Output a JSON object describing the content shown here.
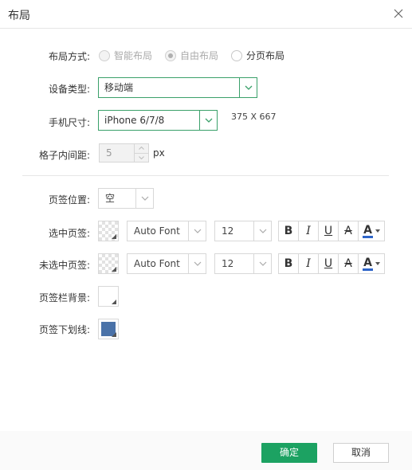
{
  "dialog": {
    "title": "布局",
    "icons": {
      "close": "close-icon",
      "dropdown": "chevron-down-icon"
    }
  },
  "layout_mode": {
    "label": "布局方式:",
    "options": [
      {
        "label": "智能布局",
        "checked": false,
        "disabled": true
      },
      {
        "label": "自由布局",
        "checked": true,
        "disabled": true
      },
      {
        "label": "分页布局",
        "checked": false,
        "disabled": false
      }
    ]
  },
  "device_type": {
    "label": "设备类型:",
    "value": "移动端"
  },
  "phone_size": {
    "label": "手机尺寸:",
    "value": "iPhone 6/7/8",
    "resolution": "375 X 667"
  },
  "cell_padding": {
    "label": "格子内间距:",
    "value": "5",
    "unit": "px"
  },
  "tab_position": {
    "label": "页签位置:",
    "value": "空"
  },
  "selected_tab": {
    "label": "选中页签:",
    "font": "Auto Font",
    "size": "12",
    "format": {
      "bold": "B",
      "italic": "I",
      "underline": "U",
      "strike": "A",
      "color": "A"
    }
  },
  "unselected_tab": {
    "label": "未选中页签:",
    "font": "Auto Font",
    "size": "12",
    "format": {
      "bold": "B",
      "italic": "I",
      "underline": "U",
      "strike": "A",
      "color": "A"
    }
  },
  "tabbar_background": {
    "label": "页签栏背景:"
  },
  "tab_underline": {
    "label": "页签下划线:",
    "color": "#4a72a8"
  },
  "colors": {
    "accent": "#1ca262",
    "border_focus": "#3aa06a",
    "font_color_bar": "#2d64c8"
  },
  "footer": {
    "ok_label": "确定",
    "cancel_label": "取消"
  }
}
